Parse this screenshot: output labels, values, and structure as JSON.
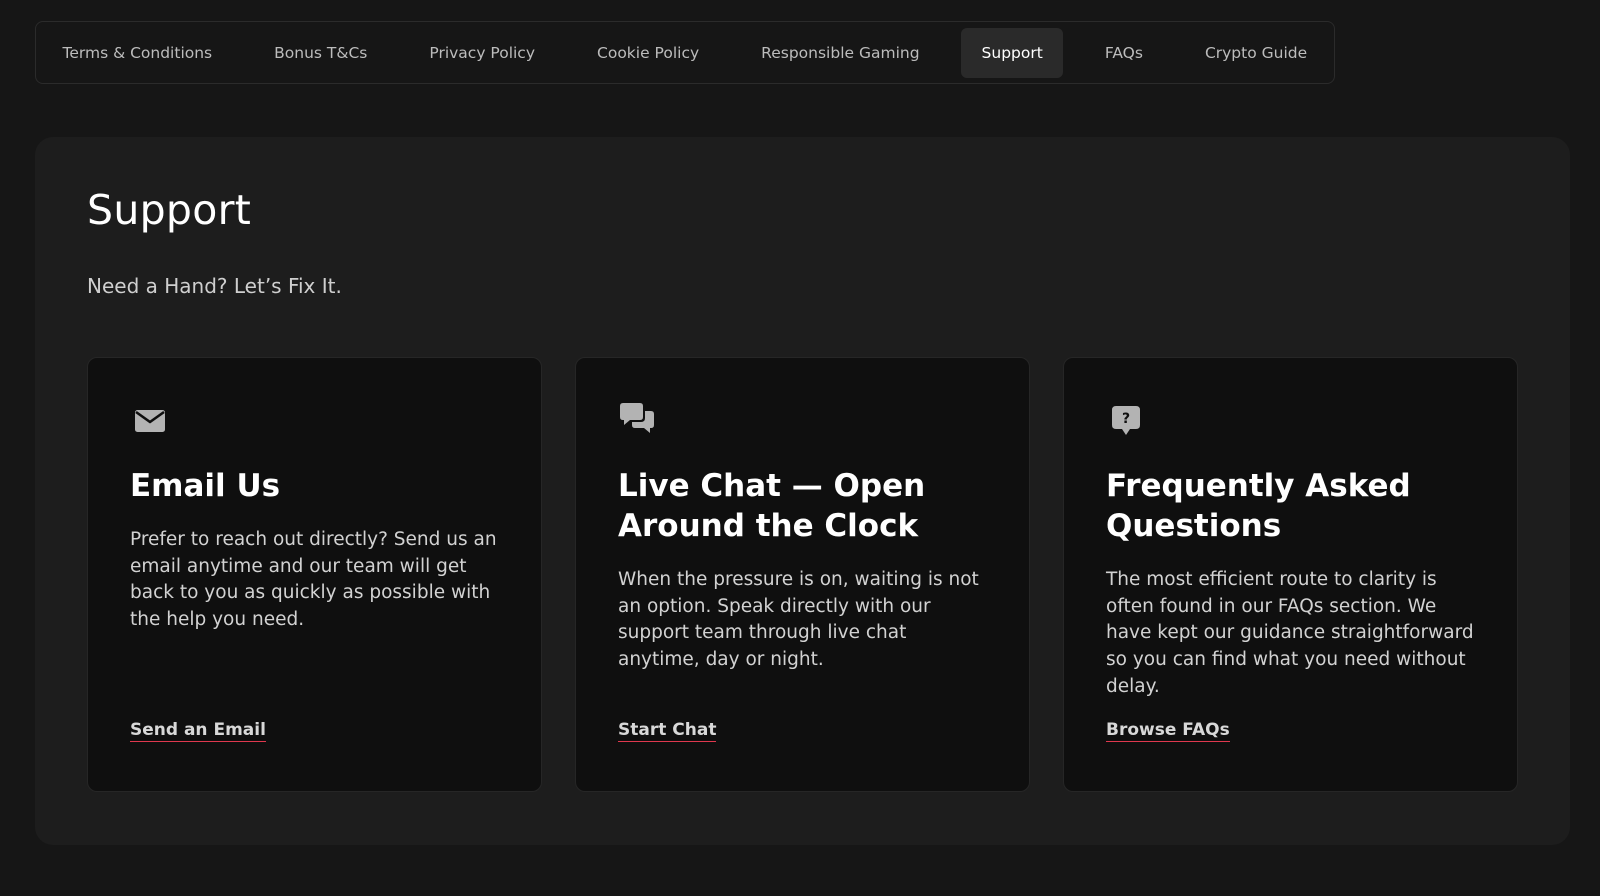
{
  "nav": {
    "tabs": [
      {
        "label": "Terms & Conditions"
      },
      {
        "label": "Bonus T&Cs"
      },
      {
        "label": "Privacy Policy"
      },
      {
        "label": "Cookie Policy"
      },
      {
        "label": "Responsible Gaming"
      },
      {
        "label": "Support",
        "active": true
      },
      {
        "label": "FAQs"
      },
      {
        "label": "Crypto Guide"
      }
    ]
  },
  "page": {
    "title": "Support",
    "subtitle": "Need a Hand? Let’s Fix It."
  },
  "cards": [
    {
      "icon": "envelope-icon",
      "title": "Email Us",
      "text": "Prefer to reach out directly? Send us an email anytime and our team will get back to you as quickly as possible with the help you need.",
      "link": "Send an Email"
    },
    {
      "icon": "chat-bubbles-icon",
      "title": "Live Chat — Open Around the Clock",
      "text": "When the pressure is on, waiting is not an option. Speak directly with our support team through live chat anytime, day or night.",
      "link": "Start Chat"
    },
    {
      "icon": "question-bubble-icon",
      "title": "Frequently Asked Questions",
      "text": "The most efficient route to clarity is often found in our FAQs section. We have kept our guidance straightforward so you can find what you need without delay.",
      "link": "Browse FAQs"
    }
  ],
  "colors": {
    "background": "#161616",
    "panel": "#1d1d1d",
    "card": "#0f0f0f",
    "active_tab": "#2a2a2a",
    "link_underline": "#e0384e",
    "icon": "#b3b3b3"
  }
}
